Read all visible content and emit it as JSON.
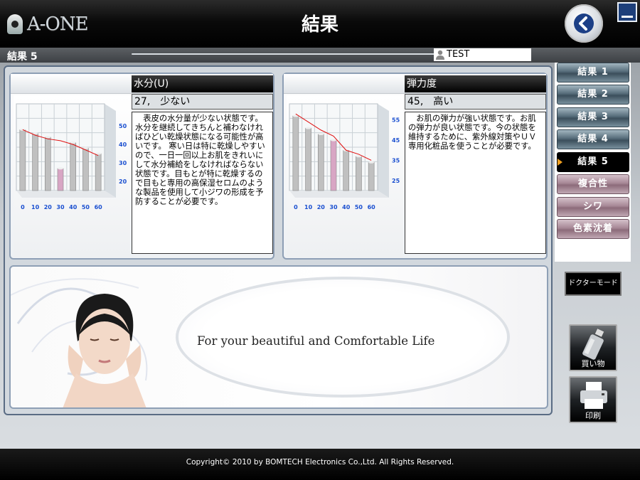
{
  "app": {
    "logo": "A-ONE",
    "title": "結果"
  },
  "subheader": {
    "title": "結果 5",
    "user": "TEST"
  },
  "panels": [
    {
      "title": "水分(U)",
      "value": "27,　少ない",
      "description": "表皮の水分量が少ない状態です。水分を継続してきちんと補わなければひどい乾燥状態になる可能性が高いです。 寒い日は特に乾燥しやすいので、一日一回以上お肌をきれいにして水分補給をしなければならない状態です。目もとが特に乾燥するので目もと専用の高保湿セロムのような製品を使用して小ジワの形成を予防することが必要です。",
      "chart": {
        "type": "bar",
        "categories": [
          "0",
          "10",
          "20",
          "30",
          "40",
          "50",
          "60"
        ],
        "y_ticks": [
          50,
          40,
          30,
          20
        ],
        "ylim": [
          15,
          62
        ],
        "values": [
          48,
          46,
          44,
          27,
          41,
          38,
          35
        ],
        "line": [
          48,
          45,
          43,
          42,
          40,
          37,
          34
        ],
        "highlight_index": 3
      }
    },
    {
      "title": "弾力度",
      "value": "45,　高い",
      "description": "お肌の弾力が強い状態です。お肌の弾力が良い状態です。今の状態を維持するために、紫外線対策やＵＶ専用化粧品を使うことが必要です。",
      "chart": {
        "type": "bar",
        "categories": [
          "0",
          "10",
          "20",
          "30",
          "40",
          "50",
          "60"
        ],
        "y_ticks": [
          55,
          45,
          35,
          25
        ],
        "ylim": [
          20,
          63
        ],
        "values": [
          57,
          51,
          48,
          45,
          40,
          37,
          34
        ],
        "line": [
          58,
          54,
          50,
          47,
          40,
          38,
          35
        ],
        "highlight_index": 3
      }
    }
  ],
  "banner": {
    "tagline": "For your beautiful and Comfortable Life"
  },
  "nav": {
    "items": [
      {
        "label": "結果 1",
        "style": "blue"
      },
      {
        "label": "結果 2",
        "style": "blue"
      },
      {
        "label": "結果 3",
        "style": "blue"
      },
      {
        "label": "結果 4",
        "style": "blue"
      },
      {
        "label": "結果 5",
        "style": "active"
      },
      {
        "label": "複合性",
        "style": "pink"
      },
      {
        "label": "シワ",
        "style": "pink"
      },
      {
        "label": "色素沈着",
        "style": "pink"
      }
    ],
    "doctor_mode": "ドクターモード",
    "shopping": "買い物",
    "print": "印刷"
  },
  "footer": {
    "copyright": "Copyright© 2010 by BOMTECH Electronics Co.,Ltd. All Rights Reserved."
  },
  "colors": {
    "bar": "#c0c0c0",
    "bar_highlight": "#d8a6c4",
    "trend_line": "#e01010",
    "axis_label": "#1a4fd0"
  }
}
